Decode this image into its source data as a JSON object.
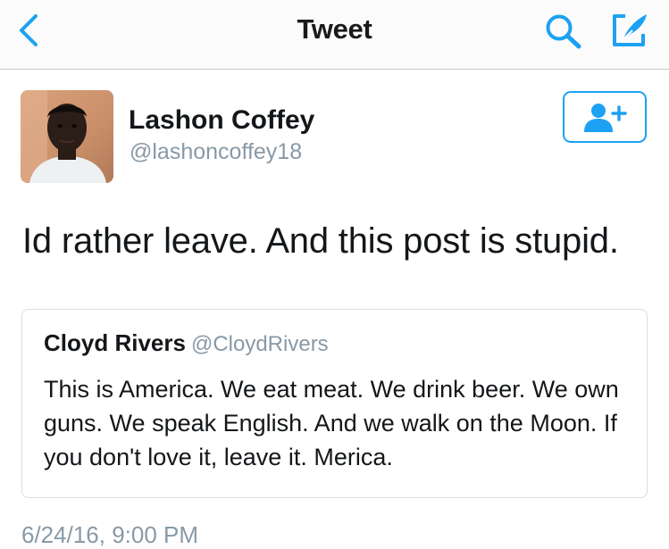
{
  "nav": {
    "title": "Tweet",
    "back_icon": "chevron-left-icon",
    "search_icon": "search-icon",
    "compose_icon": "compose-icon",
    "accent_color": "#1da1f2"
  },
  "tweet": {
    "author_name": "Lashon Coffey",
    "author_handle": "@lashoncoffey18",
    "follow_icon": "add-user-icon",
    "text": "Id rather leave. And this post is stupid.",
    "timestamp": "6/24/16, 9:00 PM"
  },
  "quoted_tweet": {
    "author_name": "Cloyd Rivers",
    "author_handle": "@CloydRivers",
    "text": "This is America. We eat meat. We drink beer. We own guns. We speak English. And we walk on the Moon. If you don't love it, leave it. Merica."
  }
}
